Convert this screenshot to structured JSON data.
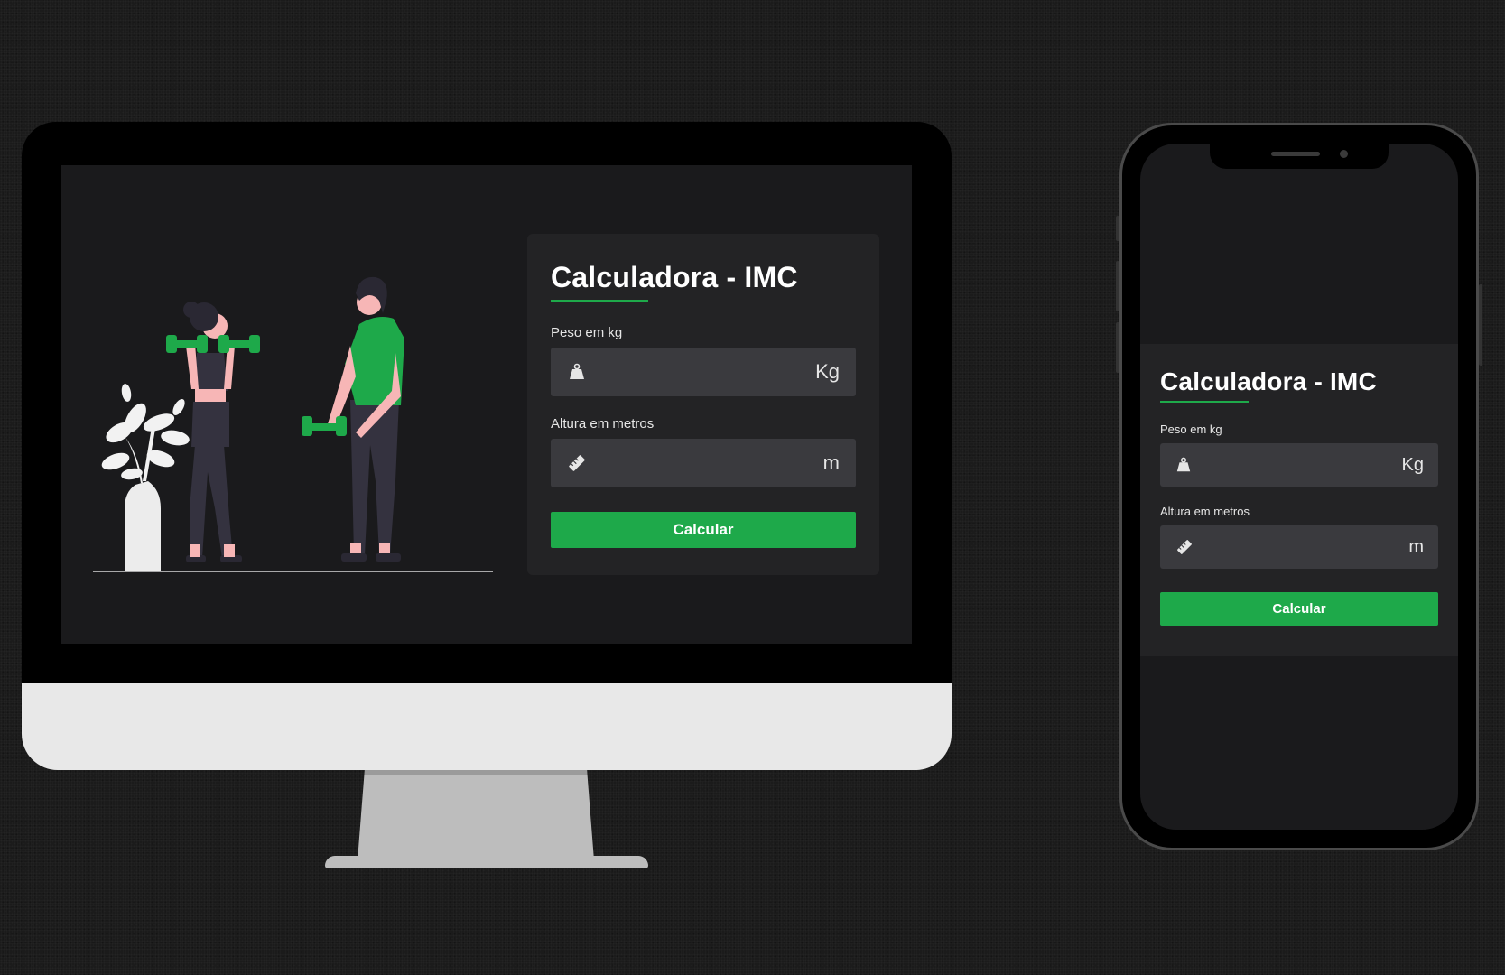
{
  "app": {
    "title": "Calculadora - IMC",
    "weight_label": "Peso em kg",
    "weight_unit": "Kg",
    "weight_icon": "weight-icon",
    "height_label": "Altura em metros",
    "height_unit": "m",
    "height_icon": "ruler-icon",
    "button_label": "Calcular"
  },
  "colors": {
    "accent": "#1ea94a",
    "background": "#1a1a1c",
    "card": "#232325",
    "input": "#3a3a3e"
  }
}
